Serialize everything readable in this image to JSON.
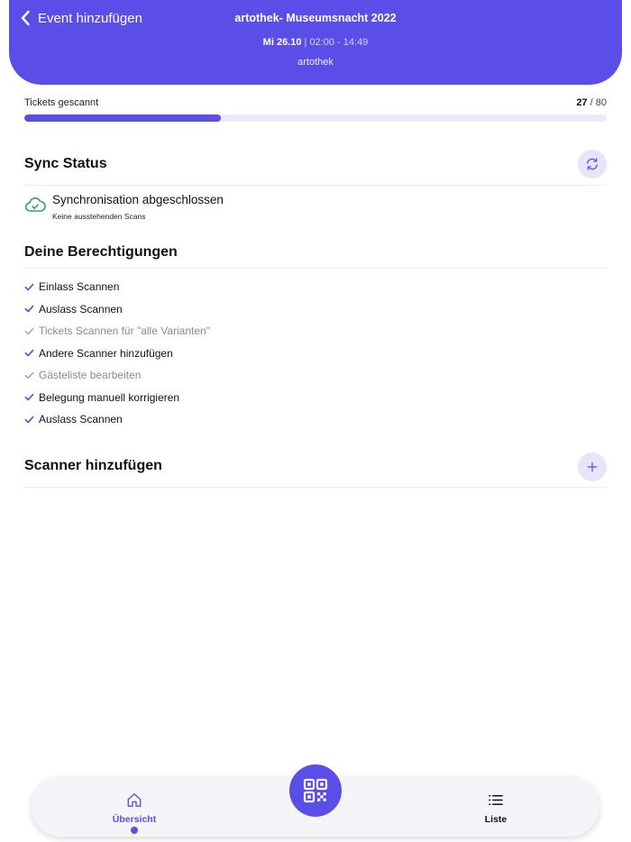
{
  "header": {
    "back_label": "Event hinzufügen",
    "title": "artothek- Museumsnacht 2022",
    "date": "Mi 26.10",
    "separator": "|",
    "time": "02:00 - 14:49",
    "venue": "artothek"
  },
  "tickets": {
    "label": "Tickets gescannt",
    "scanned": 27,
    "total": 80,
    "separator": "/"
  },
  "sync": {
    "title": "Sync Status",
    "status": "Synchronisation abgeschlossen",
    "detail": "Keine ausstehenden Scans"
  },
  "permissions": {
    "title": "Deine Berechtigungen",
    "items": [
      {
        "label": "Einlass Scannen",
        "enabled": true
      },
      {
        "label": "Auslass Scannen",
        "enabled": true
      },
      {
        "label": "Tickets Scannen für \"alle Varianten\"",
        "enabled": false
      },
      {
        "label": "Andere Scanner hinzufügen",
        "enabled": true
      },
      {
        "label": "Gästeliste bearbeiten",
        "enabled": false
      },
      {
        "label": "Belegung manuell korrigieren",
        "enabled": true
      },
      {
        "label": "Auslass Scannen",
        "enabled": true
      }
    ]
  },
  "scanners": {
    "title": "Scanner hinzufügen"
  },
  "tabbar": {
    "overview_label": "Übersicht",
    "list_label": "Liste",
    "active_tab": "overview"
  },
  "icons": {
    "back": "chevron-left-icon",
    "refresh": "refresh-icon",
    "cloud_check": "cloud-check-icon",
    "check": "check-icon",
    "plus": "plus-icon",
    "home": "home-icon",
    "list": "list-icon",
    "qr": "qr-code-icon"
  },
  "colors": {
    "accent": "#5b4de8",
    "accent_light": "#e7e4fc",
    "success": "#2fa06a",
    "disabled": "#a9a9ae"
  }
}
